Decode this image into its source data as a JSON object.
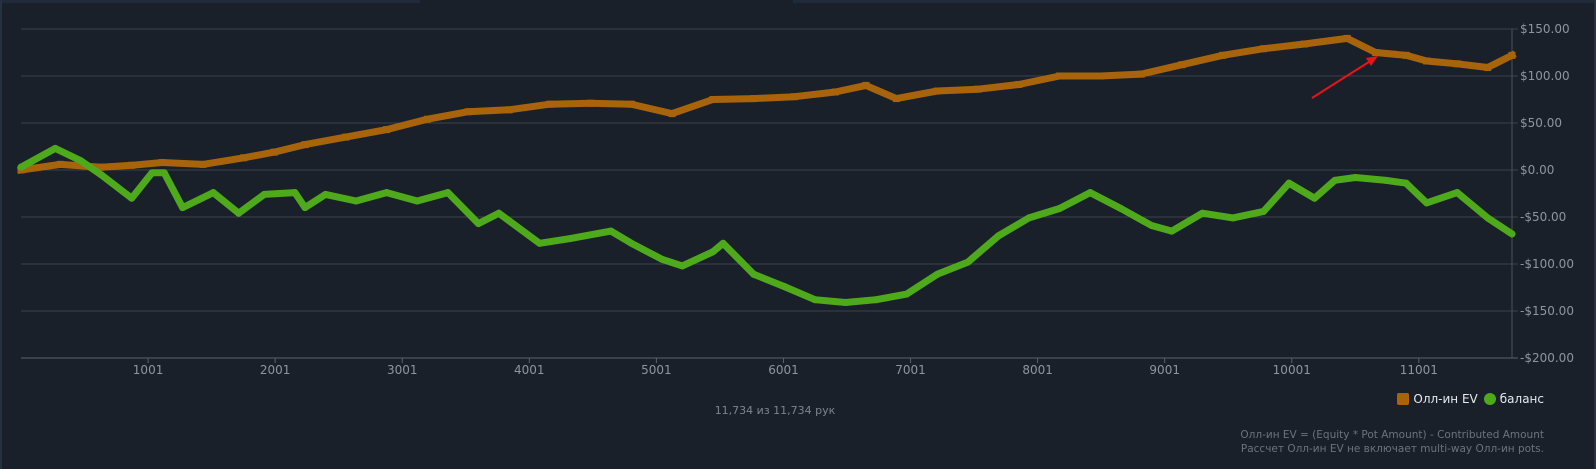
{
  "chart_data": {
    "type": "line",
    "title": "",
    "xlabel": "",
    "ylabel": "",
    "xlim": [
      1,
      11734
    ],
    "ylim": [
      -200,
      150
    ],
    "x_ticks": [
      1001,
      2001,
      3001,
      4001,
      5001,
      6001,
      7001,
      8001,
      9001,
      10001,
      11001
    ],
    "y_ticks": [
      150,
      100,
      50,
      0,
      -50,
      -100,
      -150,
      -200
    ],
    "y_tick_labels": [
      "$150.00",
      "$100.00",
      "$50.00",
      "$0.00",
      "-$50.00",
      "-$100.00",
      "-$150.00",
      "-$200.00"
    ],
    "grid": true,
    "legend_position": "bottom-right",
    "series": [
      {
        "name": "Олл-ин EV",
        "color": "#a8640a",
        "marker": "square",
        "x": [
          1,
          310,
          631,
          872,
          1112,
          1433,
          1754,
          1995,
          2236,
          2557,
          2878,
          3199,
          3520,
          3841,
          4162,
          4483,
          4804,
          5125,
          5446,
          5767,
          6088,
          6409,
          6650,
          6890,
          7211,
          7532,
          7853,
          8174,
          8495,
          8816,
          9137,
          9458,
          9779,
          10100,
          10437,
          10661,
          10901,
          11062,
          11303,
          11543,
          11734
        ],
        "y": [
          0,
          6,
          3,
          5,
          8,
          6,
          13,
          19,
          27,
          35,
          43,
          54,
          62,
          64,
          70,
          71,
          70,
          60,
          75,
          76,
          78,
          83,
          90,
          76,
          84,
          86,
          91,
          100,
          100,
          102,
          112,
          122,
          129,
          134,
          140,
          125,
          122,
          116,
          113,
          109,
          122
        ]
      },
      {
        "name": "баланс",
        "color": "#4eaa1a",
        "marker": "circle",
        "x": [
          1,
          270,
          470,
          631,
          872,
          1032,
          1128,
          1273,
          1514,
          1714,
          1915,
          2156,
          2236,
          2397,
          2638,
          2878,
          3119,
          3360,
          3600,
          3761,
          4082,
          4323,
          4644,
          4804,
          5045,
          5205,
          5446,
          5526,
          5767,
          6008,
          6249,
          6489,
          6730,
          6971,
          7211,
          7452,
          7693,
          7933,
          8174,
          8415,
          8656,
          8897,
          9057,
          9298,
          9538,
          9779,
          9979,
          10180,
          10340,
          10501,
          10741,
          10901,
          11062,
          11303,
          11543,
          11734
        ],
        "y": [
          3,
          23,
          10,
          -5,
          -30,
          -3,
          -3,
          -40,
          -24,
          -46,
          -26,
          -24,
          -40,
          -26,
          -33,
          -24,
          -33,
          -24,
          -57,
          -46,
          -78,
          -73,
          -65,
          -78,
          -95,
          -102,
          -87,
          -78,
          -111,
          -124,
          -138,
          -141,
          -138,
          -132,
          -111,
          -98,
          -70,
          -51,
          -41,
          -24,
          -41,
          -59,
          -65,
          -46,
          -51,
          -44,
          -14,
          -30,
          -11,
          -8,
          -11,
          -14,
          -35,
          -24,
          -51,
          -68
        ]
      }
    ]
  },
  "footer": {
    "hands_count": "11,734 из 11,734 рук",
    "footnote_line1": "Олл-ин EV = (Equity * Pot Amount) - Contributed Amount",
    "footnote_line2": "Рассчет Олл-ин EV не включает multi-way Олл-ин pots."
  }
}
